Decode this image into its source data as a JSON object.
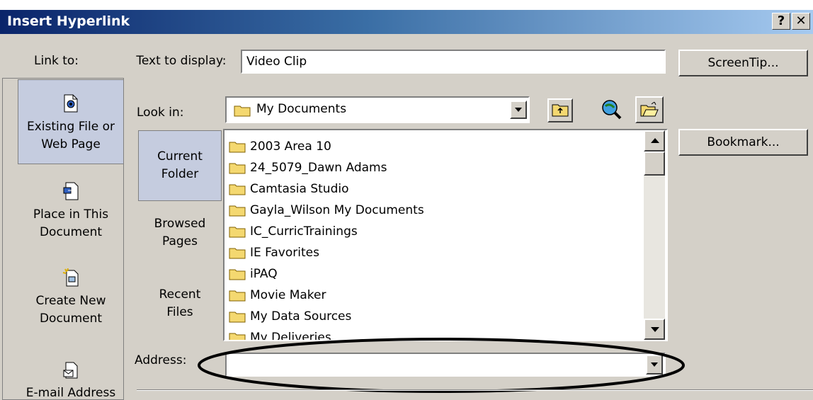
{
  "window": {
    "title": "Insert Hyperlink",
    "help_label": "?",
    "close_label": "✕"
  },
  "link_to": {
    "heading": "Link to:",
    "items": [
      {
        "label_line1": "Existing File or",
        "label_line2": "Web Page",
        "icon": "existing-file-icon"
      },
      {
        "label_line1": "Place in This",
        "label_line2": "Document",
        "icon": "place-in-document-icon"
      },
      {
        "label_line1": "Create New",
        "label_line2": "Document",
        "icon": "create-new-document-icon"
      },
      {
        "label_line1": "E-mail Address",
        "icon": "email-address-icon"
      }
    ]
  },
  "text_to_display": {
    "label": "Text to display:",
    "value": "Video Clip"
  },
  "screentip_button": "ScreenTip...",
  "bookmark_button": "Bookmark...",
  "look_in": {
    "label": "Look in:",
    "value": "My Documents"
  },
  "browse_options": [
    {
      "line1": "Current",
      "line2": "Folder"
    },
    {
      "line1": "Browsed",
      "line2": "Pages"
    },
    {
      "line1": "Recent",
      "line2": "Files"
    }
  ],
  "files": [
    "2003 Area 10",
    "24_5079_Dawn Adams",
    "Camtasia Studio",
    "Gayla_Wilson My Documents",
    "IC_CurricTrainings",
    "IE Favorites",
    "iPAQ",
    "Movie Maker",
    "My Data Sources",
    "My Deliveries"
  ],
  "address": {
    "label": "Address:",
    "value": ""
  }
}
